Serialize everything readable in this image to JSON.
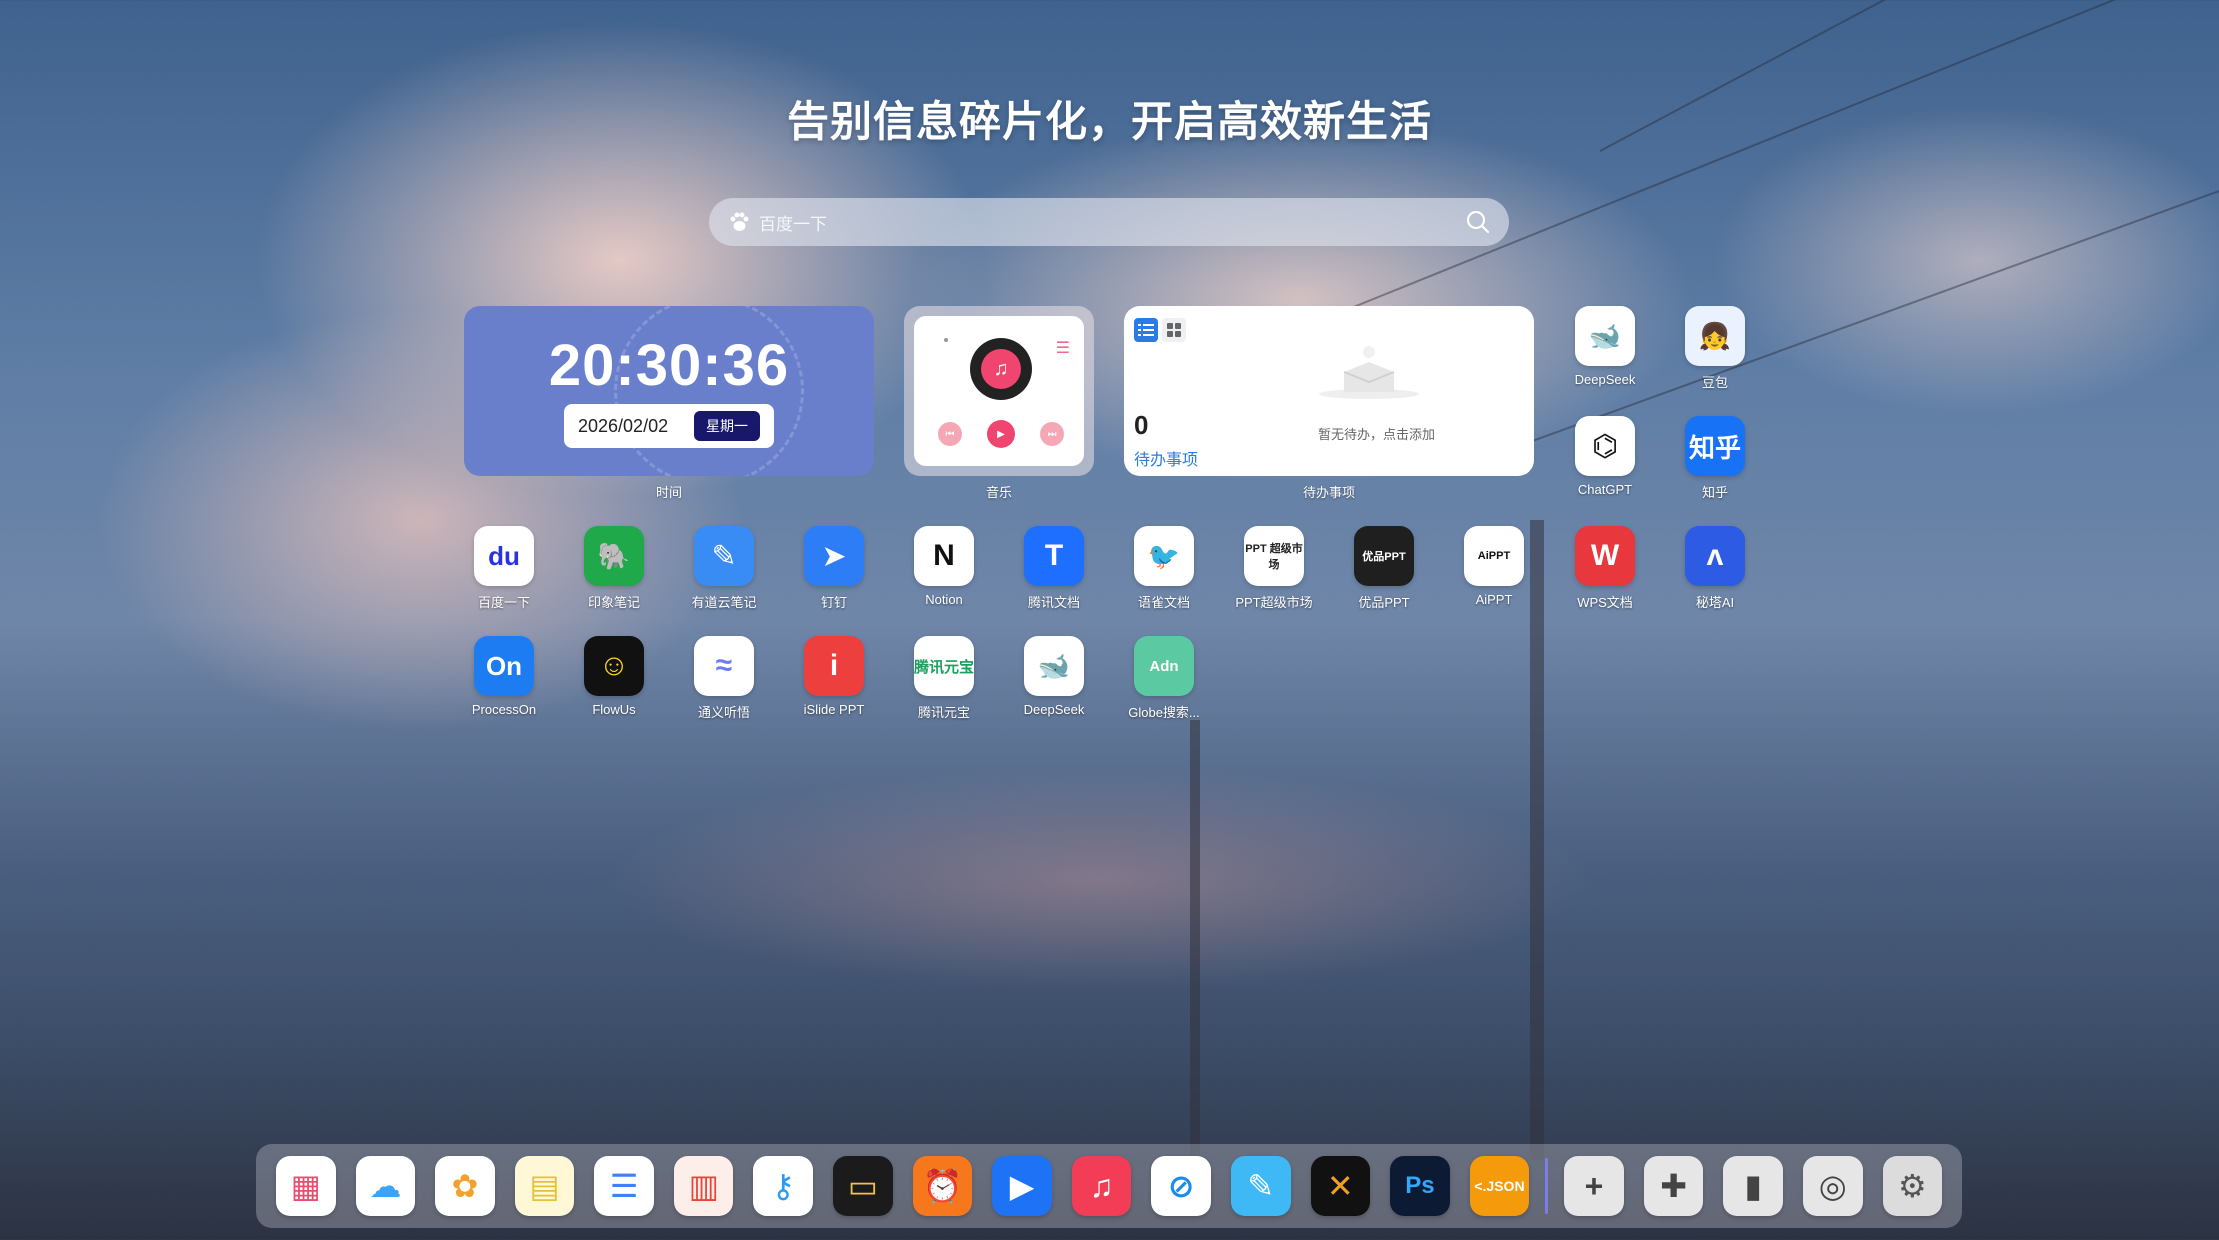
{
  "headline": "告别信息碎片化，开启高效新生活",
  "search": {
    "placeholder": "百度一下",
    "engine_icon": "baidu-paw-icon",
    "search_icon": "magnifier-icon"
  },
  "clock_widget": {
    "time": "20:30:36",
    "date": "2026/02/02",
    "weekday": "星期一",
    "label": "时间",
    "color": "#6a7fcc"
  },
  "music_widget": {
    "label": "音乐",
    "accent": "#f0456e"
  },
  "todo_widget": {
    "count": "0",
    "title": "待办事项",
    "empty_text": "暂无待办，点击添加",
    "label": "待办事项",
    "accent": "#2a7be4"
  },
  "apps": [
    {
      "name": "DeepSeek",
      "glyph": "🐋",
      "bg": "#ffffff",
      "fg": "#4d6bfe"
    },
    {
      "name": "豆包",
      "glyph": "👧",
      "bg": "#eaf1ff",
      "fg": "#333333"
    },
    {
      "name": "ChatGPT",
      "glyph": "⌬",
      "bg": "#ffffff",
      "fg": "#111111"
    },
    {
      "name": "知乎",
      "glyph": "知乎",
      "bg": "#1772f6",
      "fg": "#ffffff"
    },
    {
      "name": "百度一下",
      "glyph": "du",
      "bg": "#ffffff",
      "fg": "#2932e1"
    },
    {
      "name": "印象笔记",
      "glyph": "🐘",
      "bg": "#20a94a",
      "fg": "#ffffff"
    },
    {
      "name": "有道云笔记",
      "glyph": "✎",
      "bg": "#3a8cf5",
      "fg": "#ffffff"
    },
    {
      "name": "钉钉",
      "glyph": "➤",
      "bg": "#2c7df6",
      "fg": "#ffffff"
    },
    {
      "name": "Notion",
      "glyph": "N",
      "bg": "#ffffff",
      "fg": "#111111"
    },
    {
      "name": "腾讯文档",
      "glyph": "T",
      "bg": "#1e6fff",
      "fg": "#ffffff"
    },
    {
      "name": "语雀文档",
      "glyph": "🐦",
      "bg": "#ffffff",
      "fg": "#2fb96b"
    },
    {
      "name": "PPT超级市场",
      "glyph": "PPT 超级市场",
      "bg": "#ffffff",
      "fg": "#222222"
    },
    {
      "name": "优品PPT",
      "glyph": "优品PPT",
      "bg": "#1f1f1f",
      "fg": "#ffffff"
    },
    {
      "name": "AiPPT",
      "glyph": "AiPPT",
      "bg": "#ffffff",
      "fg": "#111111"
    },
    {
      "name": "WPS文档",
      "glyph": "W",
      "bg": "#e8383d",
      "fg": "#ffffff"
    },
    {
      "name": "秘塔AI",
      "glyph": "ʌ",
      "bg": "#2d5be3",
      "fg": "#ffffff"
    },
    {
      "name": "ProcessOn",
      "glyph": "On",
      "bg": "#1e7cf2",
      "fg": "#ffffff"
    },
    {
      "name": "FlowUs",
      "glyph": "☺",
      "bg": "#111111",
      "fg": "#ffd21f"
    },
    {
      "name": "通义听悟",
      "glyph": "≈",
      "bg": "#ffffff",
      "fg": "#6c7cf5"
    },
    {
      "name": "iSlide PPT",
      "glyph": "i",
      "bg": "#ee3f3f",
      "fg": "#ffffff"
    },
    {
      "name": "腾讯元宝",
      "glyph": "腾讯元宝",
      "bg": "#ffffff",
      "fg": "#1aa05c"
    },
    {
      "name": "DeepSeek",
      "glyph": "🐋",
      "bg": "#ffffff",
      "fg": "#4d6bfe"
    },
    {
      "name": "Globe搜索...",
      "glyph": "Adn",
      "bg": "#5bc9a2",
      "fg": "#ffffff"
    }
  ],
  "dock": [
    {
      "name": "launchpad-icon",
      "glyph": "▦",
      "bg": "#ffffff",
      "fg": "#e84d6f"
    },
    {
      "name": "icloud-icon",
      "glyph": "☁",
      "bg": "#ffffff",
      "fg": "#3da4f5"
    },
    {
      "name": "photos-icon",
      "glyph": "✿",
      "bg": "#ffffff",
      "fg": "#f2a12c"
    },
    {
      "name": "notes-icon",
      "glyph": "▤",
      "bg": "#fff8d6",
      "fg": "#e6c03a"
    },
    {
      "name": "reminders-icon",
      "glyph": "☰",
      "bg": "#ffffff",
      "fg": "#3b82f6"
    },
    {
      "name": "calendar-icon",
      "glyph": "▥",
      "bg": "#fdeee9",
      "fg": "#e6463a"
    },
    {
      "name": "passwords-icon",
      "glyph": "⚷",
      "bg": "#ffffff",
      "fg": "#2c9af2"
    },
    {
      "name": "wallet-icon",
      "glyph": "▭",
      "bg": "#1b1b1b",
      "fg": "#f3c24a"
    },
    {
      "name": "clock-icon",
      "glyph": "⏰",
      "bg": "#f7781c",
      "fg": "#ffffff"
    },
    {
      "name": "play-icon",
      "glyph": "▶",
      "bg": "#1e72f6",
      "fg": "#ffffff"
    },
    {
      "name": "music-icon",
      "glyph": "♫",
      "bg": "#f33c55",
      "fg": "#ffffff"
    },
    {
      "name": "safari-icon",
      "glyph": "⊘",
      "bg": "#ffffff",
      "fg": "#1a8cf0"
    },
    {
      "name": "freeform-icon",
      "glyph": "✎",
      "bg": "#3fb9f5",
      "fg": "#ffffff"
    },
    {
      "name": "infuse-icon",
      "glyph": "✕",
      "bg": "#111111",
      "fg": "#f0a01e"
    },
    {
      "name": "photoshop-icon",
      "glyph": "Ps",
      "bg": "#0c1a33",
      "fg": "#31a8ff"
    },
    {
      "name": "json-icon",
      "glyph": "<.JSON",
      "bg": "#f59b0b",
      "fg": "#ffffff"
    },
    {
      "name": "add-icon",
      "glyph": "+",
      "bg": "#e6e6e6",
      "fg": "#444444"
    },
    {
      "name": "puzzle-icon",
      "glyph": "✚",
      "bg": "#e6e6e6",
      "fg": "#444444"
    },
    {
      "name": "brush-icon",
      "glyph": "▮",
      "bg": "#e6e6e6",
      "fg": "#444444"
    },
    {
      "name": "settings-lens-icon",
      "glyph": "◎",
      "bg": "#e6e6e6",
      "fg": "#444444"
    },
    {
      "name": "system-settings-icon",
      "glyph": "⚙",
      "bg": "#dcdcdc",
      "fg": "#555555"
    }
  ]
}
